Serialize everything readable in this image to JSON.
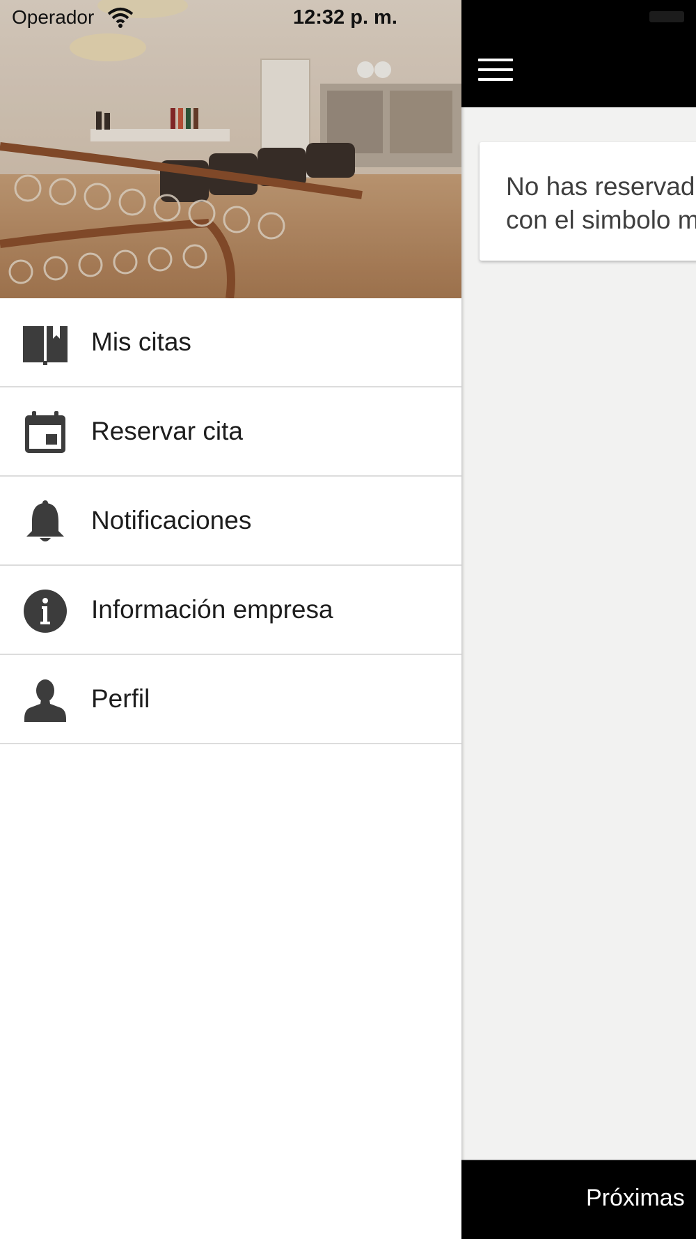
{
  "status_bar": {
    "carrier": "Operador",
    "time": "12:32 p. m.",
    "wifi_icon": "wifi-icon"
  },
  "drawer": {
    "header_image": "salon-interior-photo",
    "items": [
      {
        "label": "Mis citas",
        "icon": "book-bookmark-icon"
      },
      {
        "label": "Reservar cita",
        "icon": "calendar-icon"
      },
      {
        "label": "Notificaciones",
        "icon": "bell-icon"
      },
      {
        "label": "Información empresa",
        "icon": "info-icon"
      },
      {
        "label": "Perfil",
        "icon": "person-icon"
      }
    ]
  },
  "main": {
    "menu_icon": "hamburger-menu-icon",
    "empty_message_line1": "No has reservado",
    "empty_message_line2": "con el simbolo m",
    "bottom_tab_label": "Próximas"
  },
  "colors": {
    "topbar": "#000000",
    "background": "#f2f2f1",
    "icon": "#3c3c3c",
    "divider": "#dcdcdc"
  }
}
